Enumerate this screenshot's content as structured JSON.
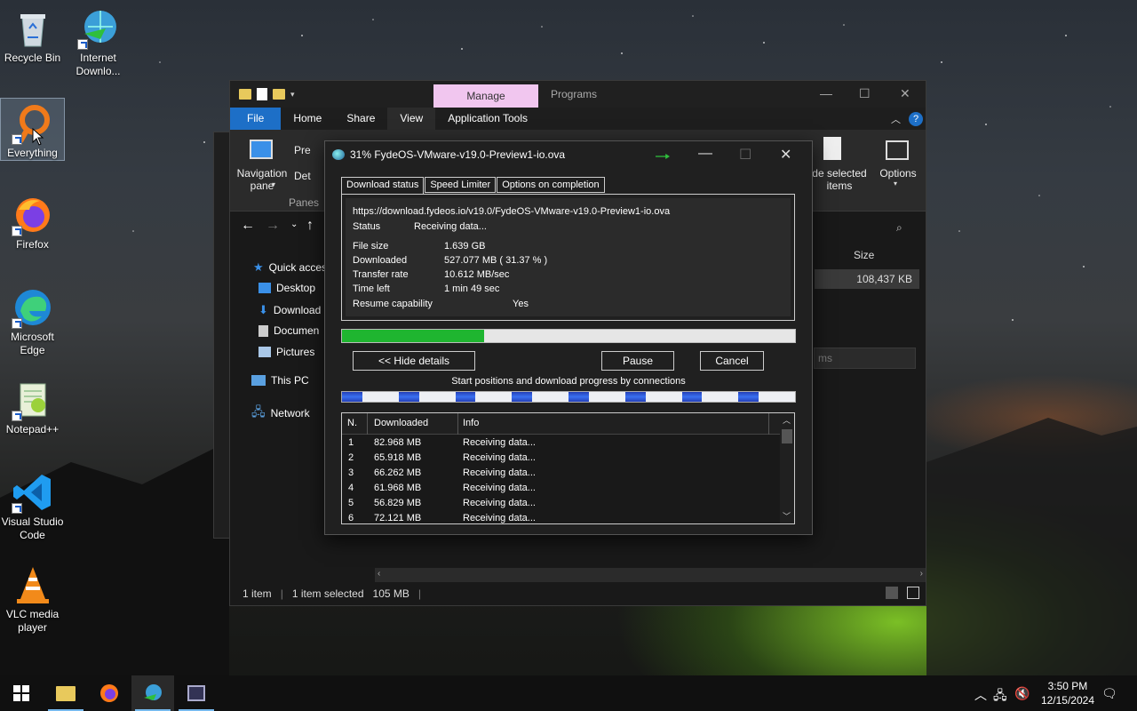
{
  "desktop": {
    "icons": [
      {
        "label": "Recycle Bin"
      },
      {
        "label": "Internet Downlo..."
      },
      {
        "label": "Everything"
      },
      {
        "label": "Firefox"
      },
      {
        "label": "Microsoft Edge"
      },
      {
        "label": "Notepad++"
      },
      {
        "label": "Visual Studio Code"
      },
      {
        "label": "VLC media player"
      }
    ]
  },
  "explorer": {
    "context_tab": "Manage",
    "programs_tab": "Programs",
    "ribbon_tabs": [
      "File",
      "Home",
      "Share",
      "View",
      "Application Tools"
    ],
    "nav_pane_label": "Navigation pane",
    "panes_label": "Panes",
    "preview_label": "Pre",
    "details_label": "Det",
    "hide_selected_label": "de selected items",
    "options_label": "Options",
    "search_placeholder": "ms",
    "column_size": "Size",
    "file_size_value": "108,437 KB",
    "nav": {
      "quick_access": "Quick acces",
      "desktop": "Desktop",
      "downloads": "Download",
      "documents": "Documen",
      "pictures": "Pictures",
      "this_pc": "This PC",
      "network": "Network"
    },
    "status": {
      "items": "1 item",
      "selected": "1 item selected",
      "size": "105 MB"
    }
  },
  "idm": {
    "title": "31% FydeOS-VMware-v19.0-Preview1-io.ova",
    "tabs": [
      "Download status",
      "Speed Limiter",
      "Options on completion"
    ],
    "url": "https://download.fydeos.io/v19.0/FydeOS-VMware-v19.0-Preview1-io.ova",
    "status_label": "Status",
    "status_value": "Receiving data...",
    "file_size_label": "File size",
    "file_size_value": "1.639  GB",
    "downloaded_label": "Downloaded",
    "downloaded_value": "527.077  MB  ( 31.37 % )",
    "transfer_rate_label": "Transfer rate",
    "transfer_rate_value": "10.612  MB/sec",
    "time_left_label": "Time left",
    "time_left_value": "1 min 49 sec",
    "resume_label": "Resume capability",
    "resume_value": "Yes",
    "progress_fraction": 0.3137,
    "hide_details_button": "<< Hide details",
    "pause_button": "Pause",
    "cancel_button": "Cancel",
    "connections_label": "Start positions and download progress by connections",
    "columns": [
      "N.",
      "Downloaded",
      "Info"
    ],
    "connections": [
      {
        "n": "1",
        "downloaded": "82.968  MB",
        "info": "Receiving data..."
      },
      {
        "n": "2",
        "downloaded": "65.918  MB",
        "info": "Receiving data..."
      },
      {
        "n": "3",
        "downloaded": "66.262  MB",
        "info": "Receiving data..."
      },
      {
        "n": "4",
        "downloaded": "61.968  MB",
        "info": "Receiving data..."
      },
      {
        "n": "5",
        "downloaded": "56.829  MB",
        "info": "Receiving data..."
      },
      {
        "n": "6",
        "downloaded": "72.121  MB",
        "info": "Receiving data..."
      }
    ]
  },
  "taskbar": {
    "time": "3:50 PM",
    "date": "12/15/2024"
  },
  "colors": {
    "progress_green": "#1fb530",
    "file_tab_blue": "#1d6fc7",
    "manage_tab_pink": "#f1c6ef",
    "connection_blue": "#3a70f0"
  }
}
